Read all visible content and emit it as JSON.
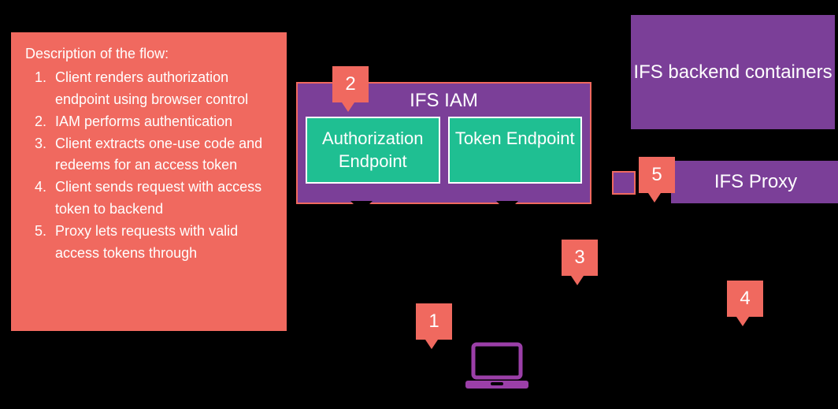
{
  "colors": {
    "accent": "#F0695F",
    "purple": "#7B3F98",
    "teal": "#1FBF92"
  },
  "description": {
    "title": "Description of the flow:",
    "steps": [
      "Client renders authorization endpoint using browser control",
      "IAM performs authentication",
      "Client extracts one-use code and redeems for an access token",
      "Client sends request with access token to backend",
      "Proxy lets requests with valid access tokens through"
    ]
  },
  "iam": {
    "title": "IFS IAM",
    "auth_endpoint": "Authorization Endpoint",
    "token_endpoint": "Token Endpoint"
  },
  "backend": {
    "label": "IFS backend containers"
  },
  "proxy": {
    "label": "IFS Proxy"
  },
  "callouts": {
    "n1": "1",
    "n2": "2",
    "n3": "3",
    "n4": "4",
    "n5": "5"
  }
}
